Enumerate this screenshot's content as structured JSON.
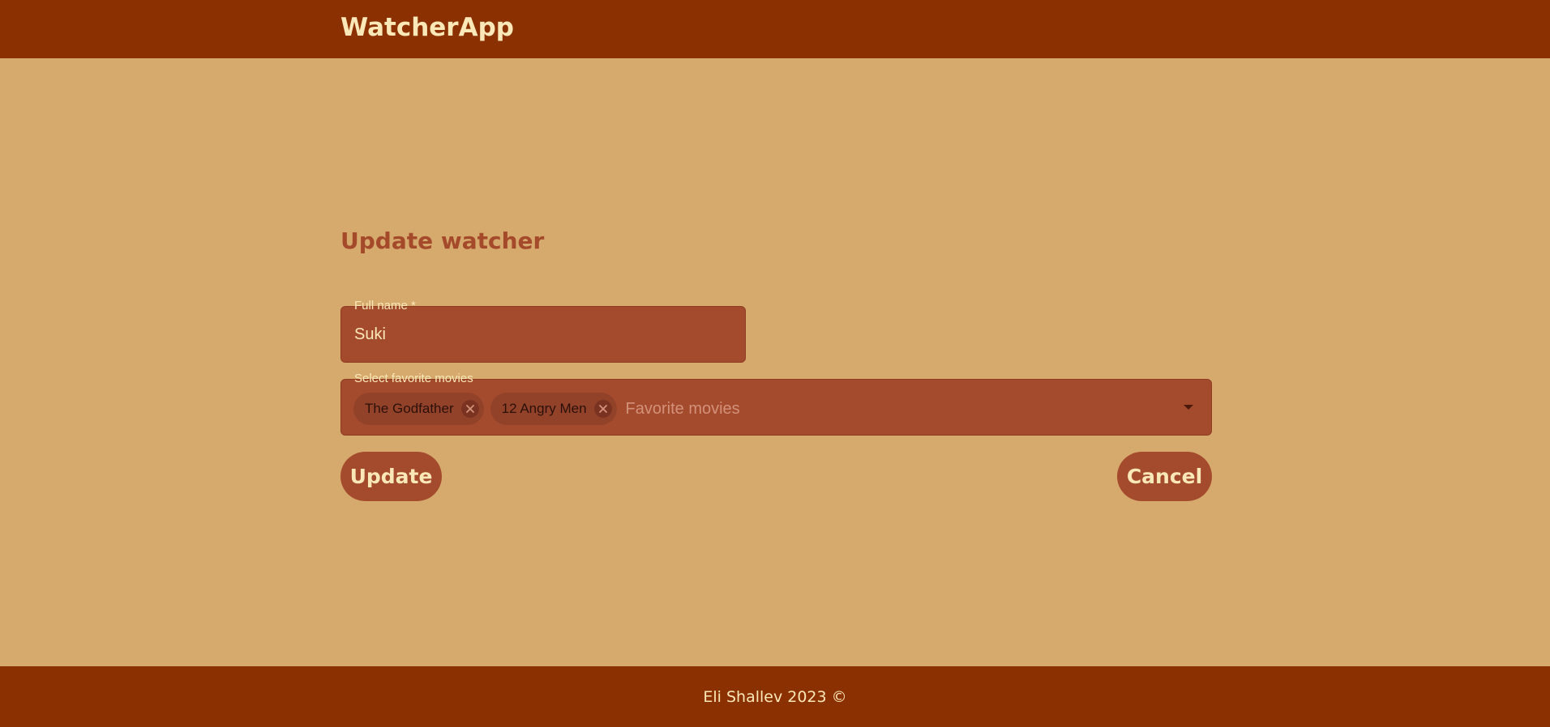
{
  "header": {
    "brand": "WatcherApp"
  },
  "main": {
    "title": "Update watcher",
    "full_name": {
      "label": "Full name *",
      "value": "Suki"
    },
    "favorite_movies": {
      "label": "Select favorite movies",
      "selected": [
        "The Godfather",
        "12 Angry Men"
      ],
      "placeholder": "Favorite movies"
    },
    "buttons": {
      "update": "Update",
      "cancel": "Cancel"
    }
  },
  "footer": {
    "text": "Eli Shallev 2023 ©"
  },
  "colors": {
    "page_bg": "#d6a96d",
    "header_bg": "#8b3000",
    "accent": "#a54b2d",
    "light_text": "#fbe8b8"
  }
}
